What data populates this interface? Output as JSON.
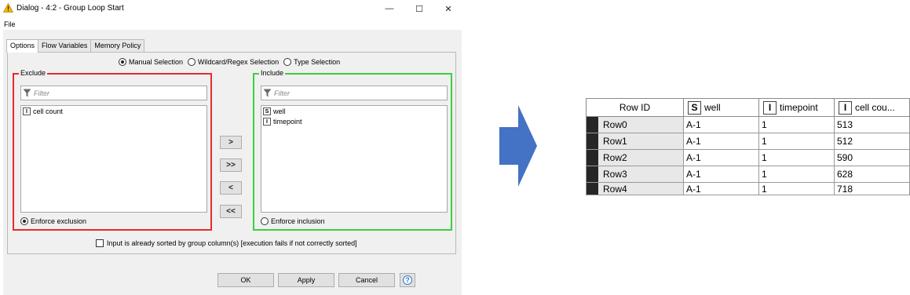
{
  "window": {
    "title": "Dialog - 4:2 - Group Loop Start",
    "minimize_glyph": "—",
    "maximize_glyph": "☐",
    "close_glyph": "✕"
  },
  "menu": {
    "file": "File"
  },
  "tabs": [
    {
      "label": "Options",
      "active": true
    },
    {
      "label": "Flow Variables",
      "active": false
    },
    {
      "label": "Memory Policy",
      "active": false
    }
  ],
  "selection_mode": {
    "options": [
      "Manual Selection",
      "Wildcard/Regex Selection",
      "Type Selection"
    ],
    "selected": "Manual Selection"
  },
  "exclude": {
    "title": "Exclude",
    "filter_placeholder": "Filter",
    "items": [
      {
        "type": "I",
        "name": "cell count"
      }
    ],
    "enforce_label": "Enforce exclusion",
    "enforce_selected": true,
    "border_color": "#e62b2b"
  },
  "include": {
    "title": "Include",
    "filter_placeholder": "Filter",
    "items": [
      {
        "type": "S",
        "name": "well"
      },
      {
        "type": "I",
        "name": "timepoint"
      }
    ],
    "enforce_label": "Enforce inclusion",
    "enforce_selected": false,
    "border_color": "#3ccf3c"
  },
  "move_buttons": {
    "add": ">",
    "add_all": ">>",
    "remove": "<",
    "remove_all": "<<"
  },
  "sorted_checkbox": {
    "label": "Input is already sorted by group column(s) [execution fails if not correctly sorted]",
    "checked": false
  },
  "buttons": {
    "ok": "OK",
    "apply": "Apply",
    "cancel": "Cancel",
    "help": "?"
  },
  "output_table": {
    "headers": [
      {
        "label": "Row ID",
        "type": ""
      },
      {
        "label": "well",
        "type": "S"
      },
      {
        "label": "timepoint",
        "type": "I"
      },
      {
        "label": "cell cou...",
        "type": "I"
      }
    ],
    "rows": [
      [
        "Row0",
        "A-1",
        "1",
        "513"
      ],
      [
        "Row1",
        "A-1",
        "1",
        "512"
      ],
      [
        "Row2",
        "A-1",
        "1",
        "590"
      ],
      [
        "Row3",
        "A-1",
        "1",
        "628"
      ],
      [
        "Row4",
        "A-1",
        "1",
        "718"
      ]
    ]
  },
  "colors": {
    "arrow": "#4472c4",
    "warning": "#f5b800",
    "help": "#2f78c4"
  }
}
